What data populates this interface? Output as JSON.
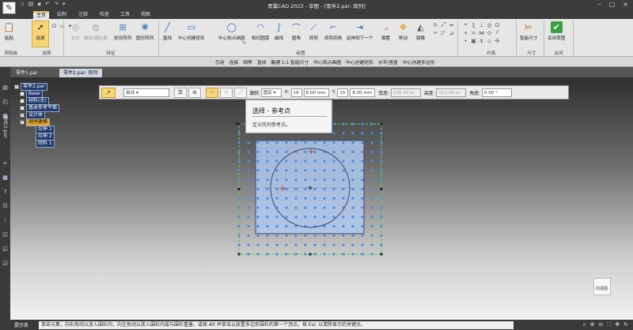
{
  "title_bar": {
    "title": "青翼CAD 2022 - 草图 - [零件2.par: 阵列]",
    "controls": [
      "–",
      "□",
      "×"
    ]
  },
  "tabs": [
    {
      "label": "主页",
      "active": true
    },
    {
      "label": "绘制",
      "active": false
    },
    {
      "label": "注释",
      "active": false
    },
    {
      "label": "检查",
      "active": false
    },
    {
      "label": "工具",
      "active": false
    },
    {
      "label": "视图",
      "active": false
    }
  ],
  "ribbon": {
    "paste": "粘贴",
    "select": "选择",
    "group_clipboard": "剪贴板",
    "group_select": "选择",
    "feature1": "长方",
    "feature2": "螺纹/圆柱面",
    "rect_pattern": "矩形阵列",
    "circ_pattern": "圆形阵列",
    "group_feature": "特征",
    "line": "直线",
    "center_rect": "中心创建矩形",
    "center_circle": "中心和点画圆",
    "tangent_arc": "相切圆弧",
    "curve": "曲线",
    "fillet": "圆角",
    "trim": "修剪",
    "trim_corner": "修剪拐角",
    "extend": "延伸到下一个",
    "offset": "偏置",
    "move": "移动",
    "mirror": "镜像",
    "group_draw": "绘图",
    "group_constraint": "约束",
    "smart_dim": "智能尺寸",
    "group_dim": "尺寸",
    "close_sketch": "关闭草图",
    "group_close": "关闭"
  },
  "snap_bar": [
    "引用",
    "连接",
    "相等",
    "直线",
    "醒通 1:1 智能尺寸",
    "中心和点画圆",
    "中心创建矩形",
    "水平/竖直",
    "中心创建多边形"
  ],
  "doc_tabs": [
    {
      "label": "零件1.par",
      "active": false
    },
    {
      "label": "零件2.par: 阵列",
      "active": true
    }
  ],
  "tree": {
    "root": "零件2.par",
    "items": [
      "Base",
      "材料(无)",
      "基本参考平面",
      "设计体",
      "顺序建模",
      "拉伸 1",
      "拉伸 2",
      "除料 1"
    ]
  },
  "cmdbar": {
    "mode": "自动",
    "fit_label": "翻转",
    "fit_value": "固定",
    "x_label": "X:",
    "x_count": "16",
    "x_spacing": "8.00 mm",
    "y_label": "Y:",
    "y_count": "15",
    "y_spacing": "8.00 mm",
    "width_label": "宽度:",
    "width_value": "120.00 m",
    "height_label": "高度:",
    "height_value": "112.00 m",
    "angle_label": "角度:",
    "angle_value": "0.00 °"
  },
  "tooltip": {
    "title": "选择 - 参考点",
    "desc": "定义阵列参考点。"
  },
  "left_bar_label": "零件2.par",
  "viewcube_label": "前视图",
  "status": {
    "label": "提示条",
    "message": "单击元素，向右拖动以放入围栏内，向左拖动以放入围栏内或与围栏重叠，或按 Alt 并单击以放置多边形围栏的第一个顶点。按 Esc 以清除显示的关键点。"
  },
  "colors": {
    "accent": "#e8b84a",
    "pattern_dot": "#4a8fe0",
    "fence": "#5fc05f",
    "highlight": "#f7d678"
  }
}
